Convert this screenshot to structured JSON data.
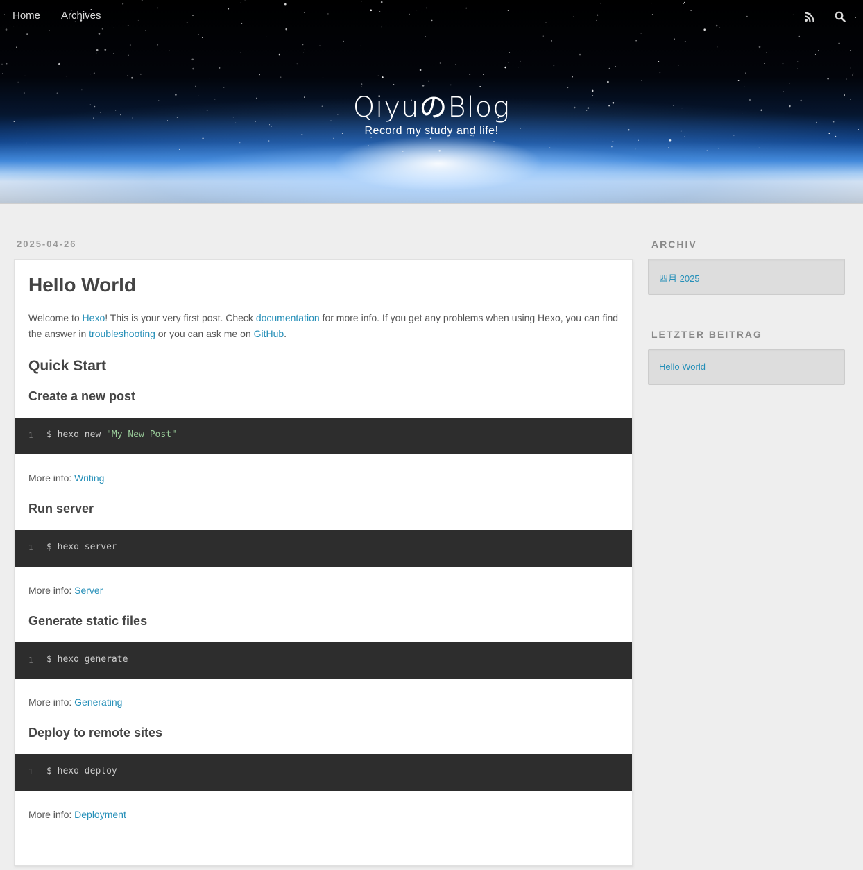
{
  "header": {
    "nav": {
      "home": "Home",
      "archives": "Archives"
    },
    "title": "QiyuのBlog",
    "subtitle": "Record my study and life!",
    "icons": [
      "rss-icon",
      "search-icon"
    ]
  },
  "post": {
    "date": "2025-04-26",
    "title": "Hello World",
    "intro": {
      "t1": "Welcome to ",
      "link_hexo": "Hexo",
      "t2": "! This is your very first post. Check ",
      "link_docs": "documentation",
      "t3": " for more info. If you get any problems when using Hexo, you can find the answer in ",
      "link_trouble": "troubleshooting",
      "t4": " or you can ask me on ",
      "link_github": "GitHub",
      "t5": "."
    },
    "quick_start": "Quick Start",
    "more_label": "More info: ",
    "sections": [
      {
        "heading": "Create a new post",
        "line_no": "1",
        "cmd": "$ hexo new ",
        "str": "\"My New Post\"",
        "link": "Writing"
      },
      {
        "heading": "Run server",
        "line_no": "1",
        "cmd": "$ hexo server",
        "link": "Server"
      },
      {
        "heading": "Generate static files",
        "line_no": "1",
        "cmd": "$ hexo generate",
        "link": "Generating"
      },
      {
        "heading": "Deploy to remote sites",
        "line_no": "1",
        "cmd": "$ hexo deploy",
        "link": "Deployment"
      }
    ]
  },
  "sidebar": {
    "archive_title": "ARCHIV",
    "archive_item": "四月 2025",
    "recent_title": "LETZTER BEITRAG",
    "recent_item": "Hello World"
  },
  "colors": {
    "link": "#258fb8",
    "code_bg": "#2d2d2d",
    "page_bg": "#eeeeee"
  }
}
